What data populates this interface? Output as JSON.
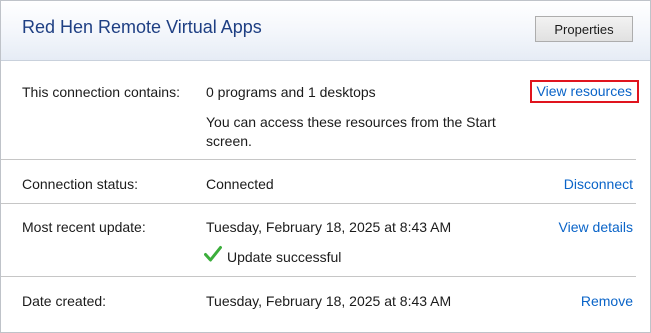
{
  "connection": {
    "title": "Red Hen Remote Virtual Apps",
    "properties_label": "Properties"
  },
  "rows": {
    "contains": {
      "label": "This connection contains:",
      "value": "0 programs and 1 desktops",
      "note": "You can access these resources from the Start screen.",
      "action": "View resources"
    },
    "status": {
      "label": "Connection status:",
      "value": "Connected",
      "action": "Disconnect"
    },
    "update": {
      "label": "Most recent update:",
      "value": "Tuesday, February 18, 2025 at 8:43 AM",
      "result": "Update successful",
      "action": "View details"
    },
    "created": {
      "label": "Date created:",
      "value": "Tuesday, February 18, 2025 at 8:43 AM",
      "action": "Remove"
    }
  },
  "icons": {
    "update_result": "checkmark-icon"
  },
  "colors": {
    "title": "#1e3f83",
    "link": "#0a64c8",
    "highlight_box": "#e0141e",
    "check": "#3cae3c"
  }
}
